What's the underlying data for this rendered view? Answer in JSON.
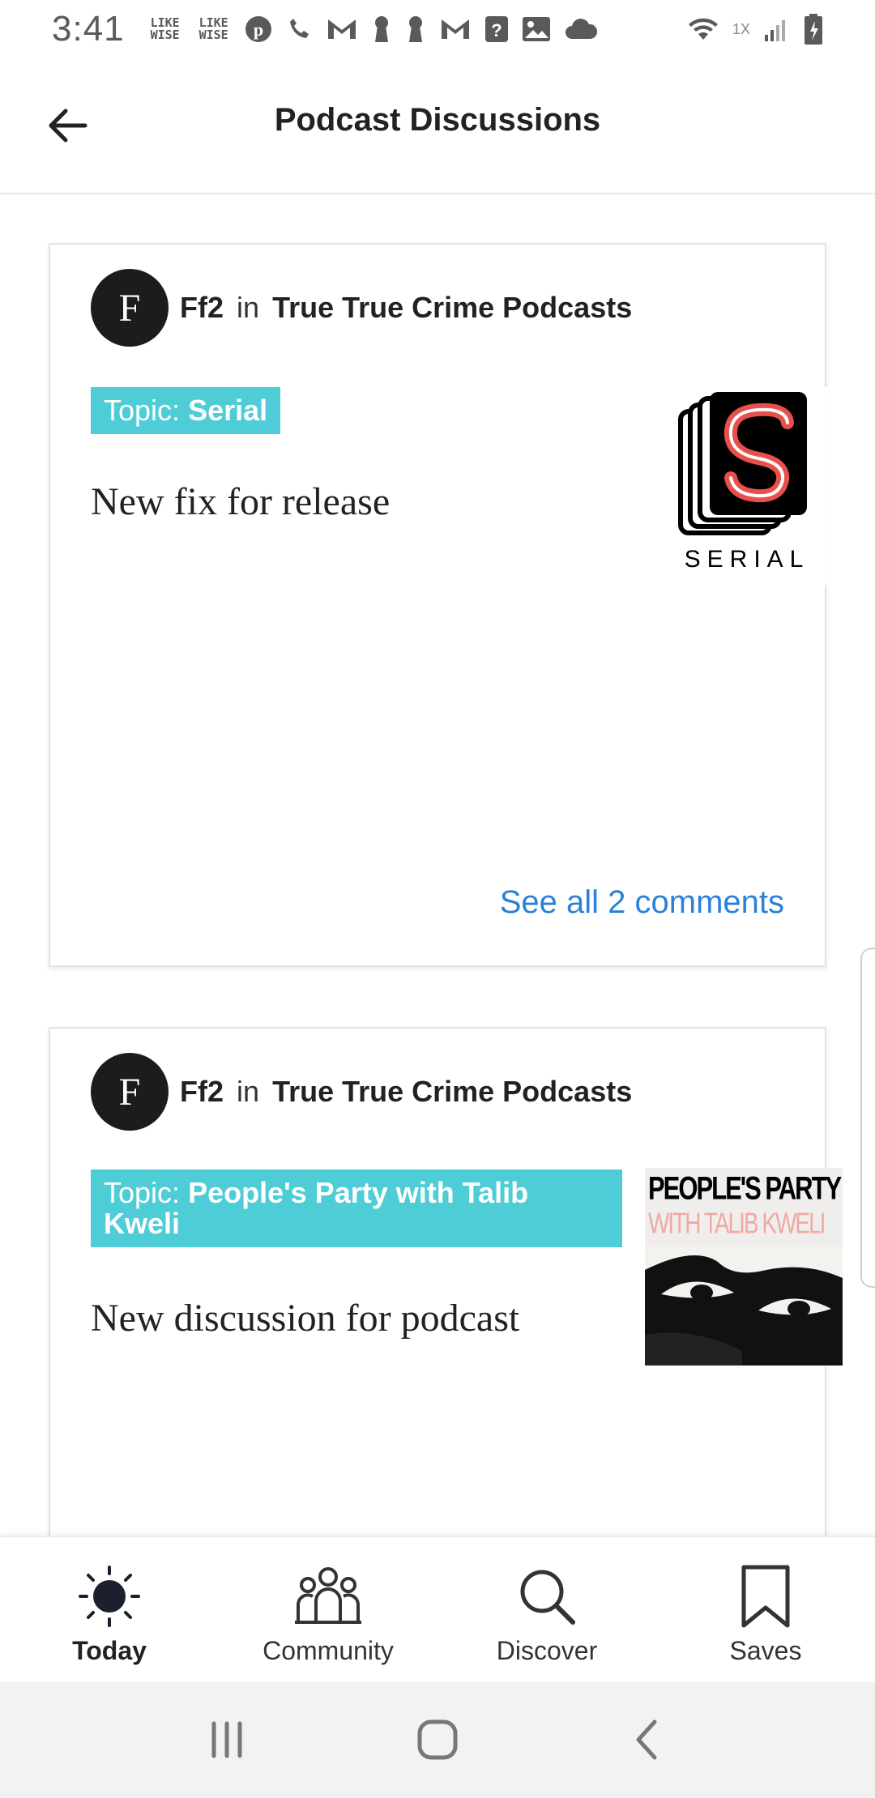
{
  "status_bar": {
    "time": "3:41",
    "likewise_1": "LIKE\nWISE",
    "likewise_2": "LIKE\nWISE",
    "speed": "1X"
  },
  "app_bar": {
    "title": "Podcast Discussions"
  },
  "posts": [
    {
      "avatar_letter": "F",
      "author": "Ff2",
      "in_text": "in",
      "community": "True True Crime Podcasts",
      "topic_prefix": "Topic:",
      "topic": "Serial",
      "title": "New fix for release",
      "cover_text": "SERIAL",
      "comments_link": "See all 2 comments"
    },
    {
      "avatar_letter": "F",
      "author": "Ff2",
      "in_text": "in",
      "community": "True True Crime Podcasts",
      "topic_prefix": "Topic:",
      "topic": "People's Party with Talib Kweli",
      "title": "New discussion for podcast",
      "cover_line1": "PEOPLE'S PARTY",
      "cover_line2": "WITH TALIB KWELI"
    }
  ],
  "bottom_nav": {
    "items": [
      {
        "label": "Today",
        "icon": "sun-icon",
        "active": true
      },
      {
        "label": "Community",
        "icon": "people-icon",
        "active": false
      },
      {
        "label": "Discover",
        "icon": "search-icon",
        "active": false
      },
      {
        "label": "Saves",
        "icon": "bookmark-icon",
        "active": false
      }
    ]
  },
  "colors": {
    "topic_badge": "#4fcdd7",
    "link": "#2a82d8",
    "serial_red": "#e8504b"
  }
}
